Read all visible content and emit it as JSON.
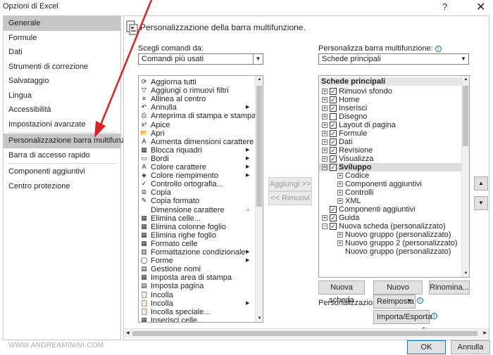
{
  "window": {
    "title": "Opzioni di Excel",
    "help": "?",
    "close": "✕"
  },
  "sidebar": {
    "items": [
      "Generale",
      "Formule",
      "Dati",
      "Strumenti di correzione",
      "Salvataggio",
      "Lingua",
      "Accessibilità",
      "Impostazioni avanzate",
      "Personalizzazione barra multifunzione",
      "Barra di accesso rapido",
      "Componenti aggiuntivi",
      "Centro protezione"
    ]
  },
  "main": {
    "heading": "Personalizzazione della barra multifunzione.",
    "left_label": "Scegli comandi da:",
    "left_combo": "Comandi più usati",
    "right_label": "Personalizza barra multifunzione:",
    "right_combo": "Schede principali",
    "commands": [
      "Aggiorna tutti",
      "Aggiungi o rimuovi filtri",
      "Allinea al centro",
      "Annulla",
      "Anteprima di stampa e stampa",
      "Apice",
      "Apri",
      "Aumenta dimensioni carattere",
      "Blocca riquadri",
      "Bordi",
      "Colore carattere",
      "Colore riempimento",
      "Controllo ortografia...",
      "Copia",
      "Copia formato",
      "Dimensione carattere",
      "Elimina celle...",
      "Elimina colonne foglio",
      "Elimina righe foglio",
      "Formato celle",
      "Formattazione condizionale",
      "Forme",
      "Gestione nomi",
      "Imposta area di stampa",
      "Imposta pagina",
      "Incolla",
      "Incolla",
      "Incolla speciale...",
      "Inserisci celle..."
    ],
    "add_btn": "Aggiungi >>",
    "remove_btn": "<< Rimuovi",
    "tree_header": "Schede principali",
    "tree": [
      "Rimuovi sfondo",
      "Home",
      "Inserisci",
      "Disegno",
      "Layout di pagina",
      "Formule",
      "Dati",
      "Revisione",
      "Visualizza",
      "Sviluppo",
      "Codice",
      "Componenti aggiuntivi",
      "Controlli",
      "XML",
      "Componenti aggiuntivi",
      "Guida",
      "Nuova scheda (personalizzato)",
      "Nuovo gruppo (personalizzato)",
      "Nuovo gruppo 2 (personalizzato)",
      "Nuovo gruppo (personalizzato)"
    ],
    "new_tab_btn": "Nuova scheda",
    "new_group_btn": "Nuovo gruppo",
    "rename_btn": "Rinomina...",
    "custom_label": "Personalizzazioni:",
    "reset_btn": "Reimposta",
    "import_btn": "Importa/Esporta",
    "up": "▲",
    "down": "▼"
  },
  "footer": {
    "watermark": "WWW.ANDREAMININI.COM",
    "ok": "OK",
    "cancel": "Annulla"
  }
}
